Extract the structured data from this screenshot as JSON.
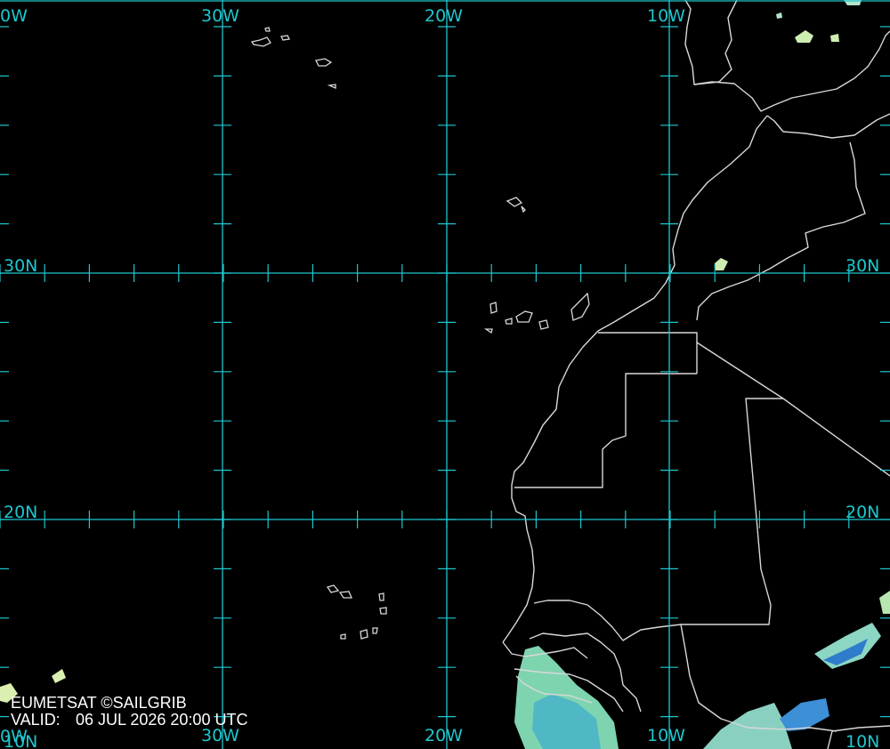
{
  "map": {
    "colors": {
      "background": "#000000",
      "graticule": "#1ec7cf",
      "coastline": "#d8d8d8",
      "cloud_light": "#d7f0b8",
      "cloud_mid": "#5cc6c0",
      "cloud_deep": "#2c7fd0",
      "label_text": "#1ec7cf",
      "credit_text": "#ffffff"
    },
    "longitude_labels_top": [
      "0W",
      "30W",
      "20W",
      "10W"
    ],
    "longitude_labels_bottom": [
      "0W",
      "30W",
      "20W",
      "10W",
      "10N"
    ],
    "latitude_labels_left": [
      "30N",
      "20N",
      "10N"
    ],
    "latitude_labels_right": [
      "30N",
      "20N"
    ],
    "credit": "EUMETSAT ©SAILGRIB",
    "valid_label": "VALID:",
    "valid_time": "06 JUL 2026 20:00 UTC"
  }
}
